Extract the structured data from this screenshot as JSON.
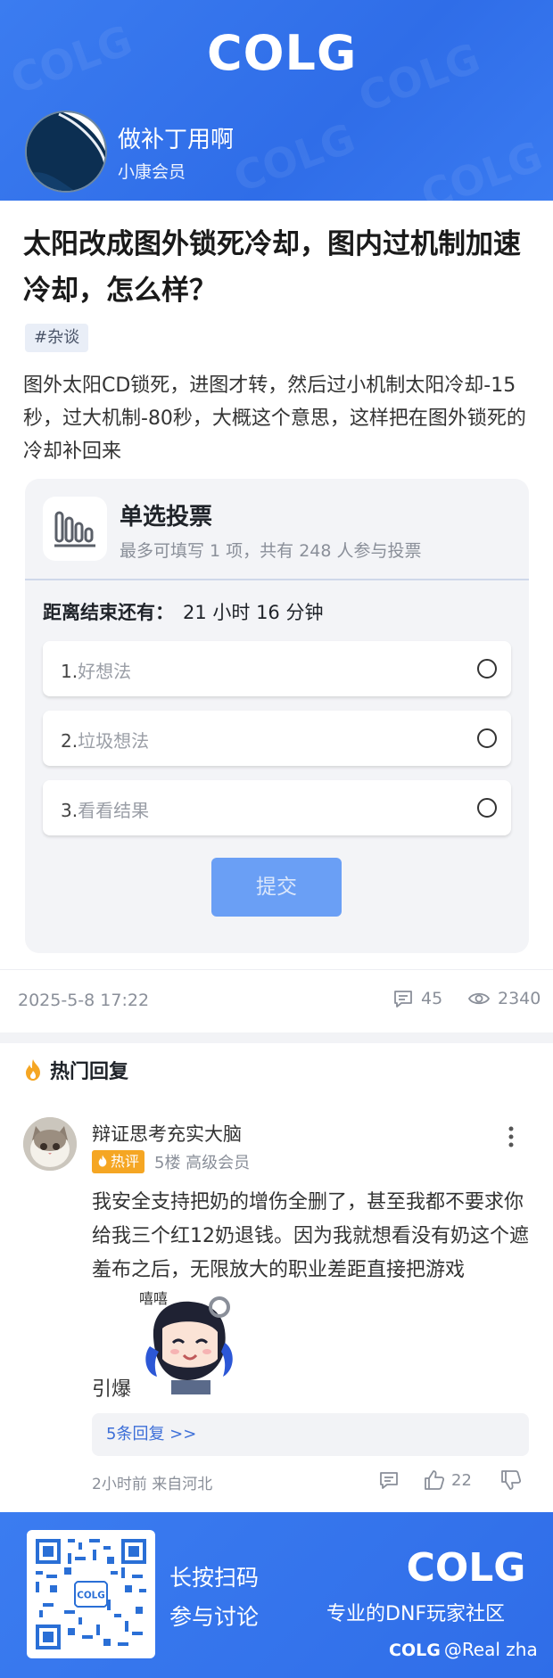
{
  "header": {
    "logo_text": "COLG",
    "username": "做补丁用啊",
    "user_level": "小康会员"
  },
  "post": {
    "title": "太阳改成图外锁死冷却，图内过机制加速冷却，怎么样？",
    "tag": "#杂谈",
    "body": "图外太阳CD锁死，进图才转，然后过小机制太阳冷却-15秒，过大机制-80秒，大概这个意思，这样把在图外锁死的冷却补回来"
  },
  "poll": {
    "title": "单选投票",
    "subtitle": "最多可填写 1 项，共有 248 人参与投票",
    "countdown_label": "距离结束还有：",
    "countdown_value": "21 小时 16 分钟",
    "options": [
      {
        "num": "1.",
        "text": "好想法"
      },
      {
        "num": "2.",
        "text": "垃圾想法"
      },
      {
        "num": "3.",
        "text": "看看结果"
      }
    ],
    "submit_label": "提交"
  },
  "meta": {
    "date": "2025-5-8 17:22",
    "comment_count": "45",
    "view_count": "2340"
  },
  "hot_replies": {
    "header": "热门回复",
    "reply": {
      "author": "辩证思考充实大脑",
      "badge": "热评",
      "floor_info": "5楼 高级会员",
      "text": "我安全支持把奶的增伤全删了，甚至我都不要求你给我三个红12奶退钱。因为我就想看没有奶这个遮羞布之后，无限放大的职业差距直接把游戏",
      "text_end": "引爆",
      "sticker_text": "嘻嘻",
      "sub_replies": "5条回复 >>",
      "time": "2小时前 来自河北",
      "like_count": "22"
    }
  },
  "footer": {
    "cta_line1": "长按扫码",
    "cta_line2": "参与讨论",
    "logo_text": "COLG",
    "slogan": "专业的DNF玩家社区",
    "watermark_logo": "COLG",
    "watermark_user": "@Real zha"
  },
  "colors": {
    "brand_blue": "#2f6de8",
    "button_blue": "#6a9ff5",
    "hot_orange": "#f5a623",
    "link_blue": "#3d6fd8"
  }
}
